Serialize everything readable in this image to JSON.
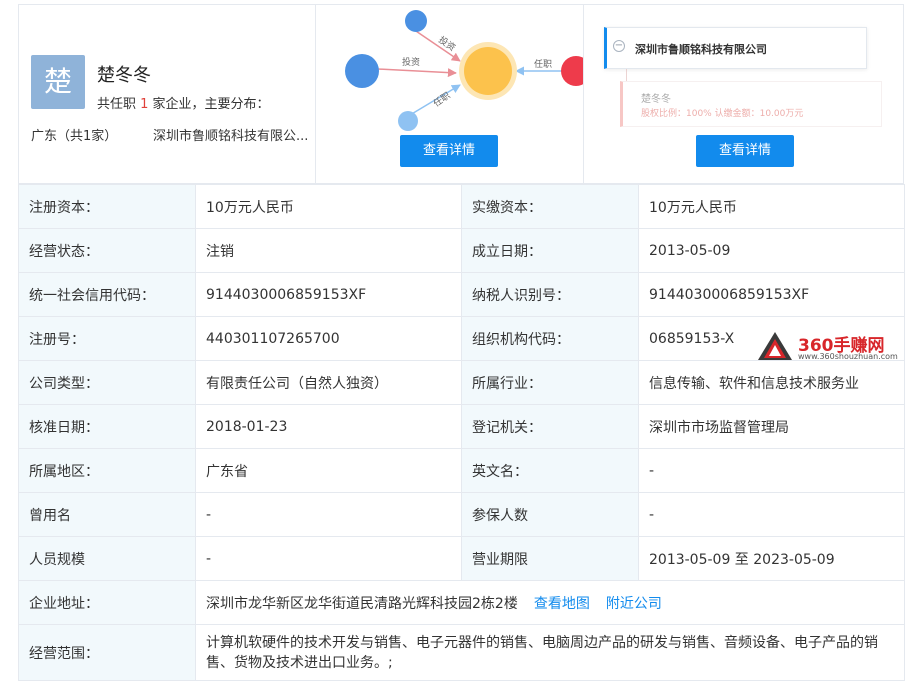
{
  "person": {
    "avatar_char": "楚",
    "name": "楚冬冬",
    "title_prefix": "共任职 ",
    "title_count": "1",
    "title_suffix": " 家企业，主要分布：",
    "region": "广东（共1家）",
    "company_short": "深圳市鲁顺铭科技有限公..."
  },
  "graph": {
    "edge_invest_1": "投资",
    "edge_invest_2": "投资",
    "edge_invest_3": "任职",
    "edge_role": "任职",
    "button": "查看详情",
    "colors": {
      "blue": "#4a90e2",
      "orange": "#fcc24c",
      "red": "#ee3b4b",
      "light_blue": "#8fc2f2"
    }
  },
  "tree": {
    "company": "深圳市鲁顺铭科技有限公司",
    "child_name": "楚冬冬",
    "child_detail": "股权比例：100%    认缴金额：10.00万元",
    "button": "查看详情"
  },
  "info": {
    "reg_capital_label": "注册资本：",
    "reg_capital": "10万元人民币",
    "paid_capital_label": "实缴资本：",
    "paid_capital": "10万元人民币",
    "status_label": "经营状态：",
    "status": "注销",
    "found_label": "成立日期：",
    "found": "2013-05-09",
    "credit_label": "统一社会信用代码：",
    "credit": "9144030006859153XF",
    "tax_label": "纳税人识别号：",
    "tax": "9144030006859153XF",
    "regno_label": "注册号：",
    "regno": "440301107265700",
    "org_label": "组织机构代码：",
    "org": "06859153-X",
    "type_label": "公司类型：",
    "type": "有限责任公司（自然人独资）",
    "industry_label": "所属行业：",
    "industry": "信息传输、软件和信息技术服务业",
    "approve_label": "核准日期：",
    "approve": "2018-01-23",
    "authority_label": "登记机关：",
    "authority": "深圳市市场监督管理局",
    "area_label": "所属地区：",
    "area": "广东省",
    "en_label": "英文名：",
    "en": "-",
    "former_label": "曾用名",
    "former": "-",
    "insured_label": "参保人数",
    "insured": "-",
    "size_label": "人员规模",
    "size": "-",
    "term_label": "营业期限",
    "term": "2013-05-09 至 2023-05-09",
    "address_label": "企业地址：",
    "address": "深圳市龙华新区龙华街道民清路光辉科技园2栋2楼",
    "map_link": "查看地图",
    "nearby_link": "附近公司",
    "scope_label": "经营范围：",
    "scope": "计算机软硬件的技术开发与销售、电子元器件的销售、电脑周边产品的研发与销售、音频设备、电子产品的销售、货物及技术进出口业务。;"
  },
  "watermark": {
    "title": "360手赚网",
    "url": "www.360shouzhuan.com"
  }
}
